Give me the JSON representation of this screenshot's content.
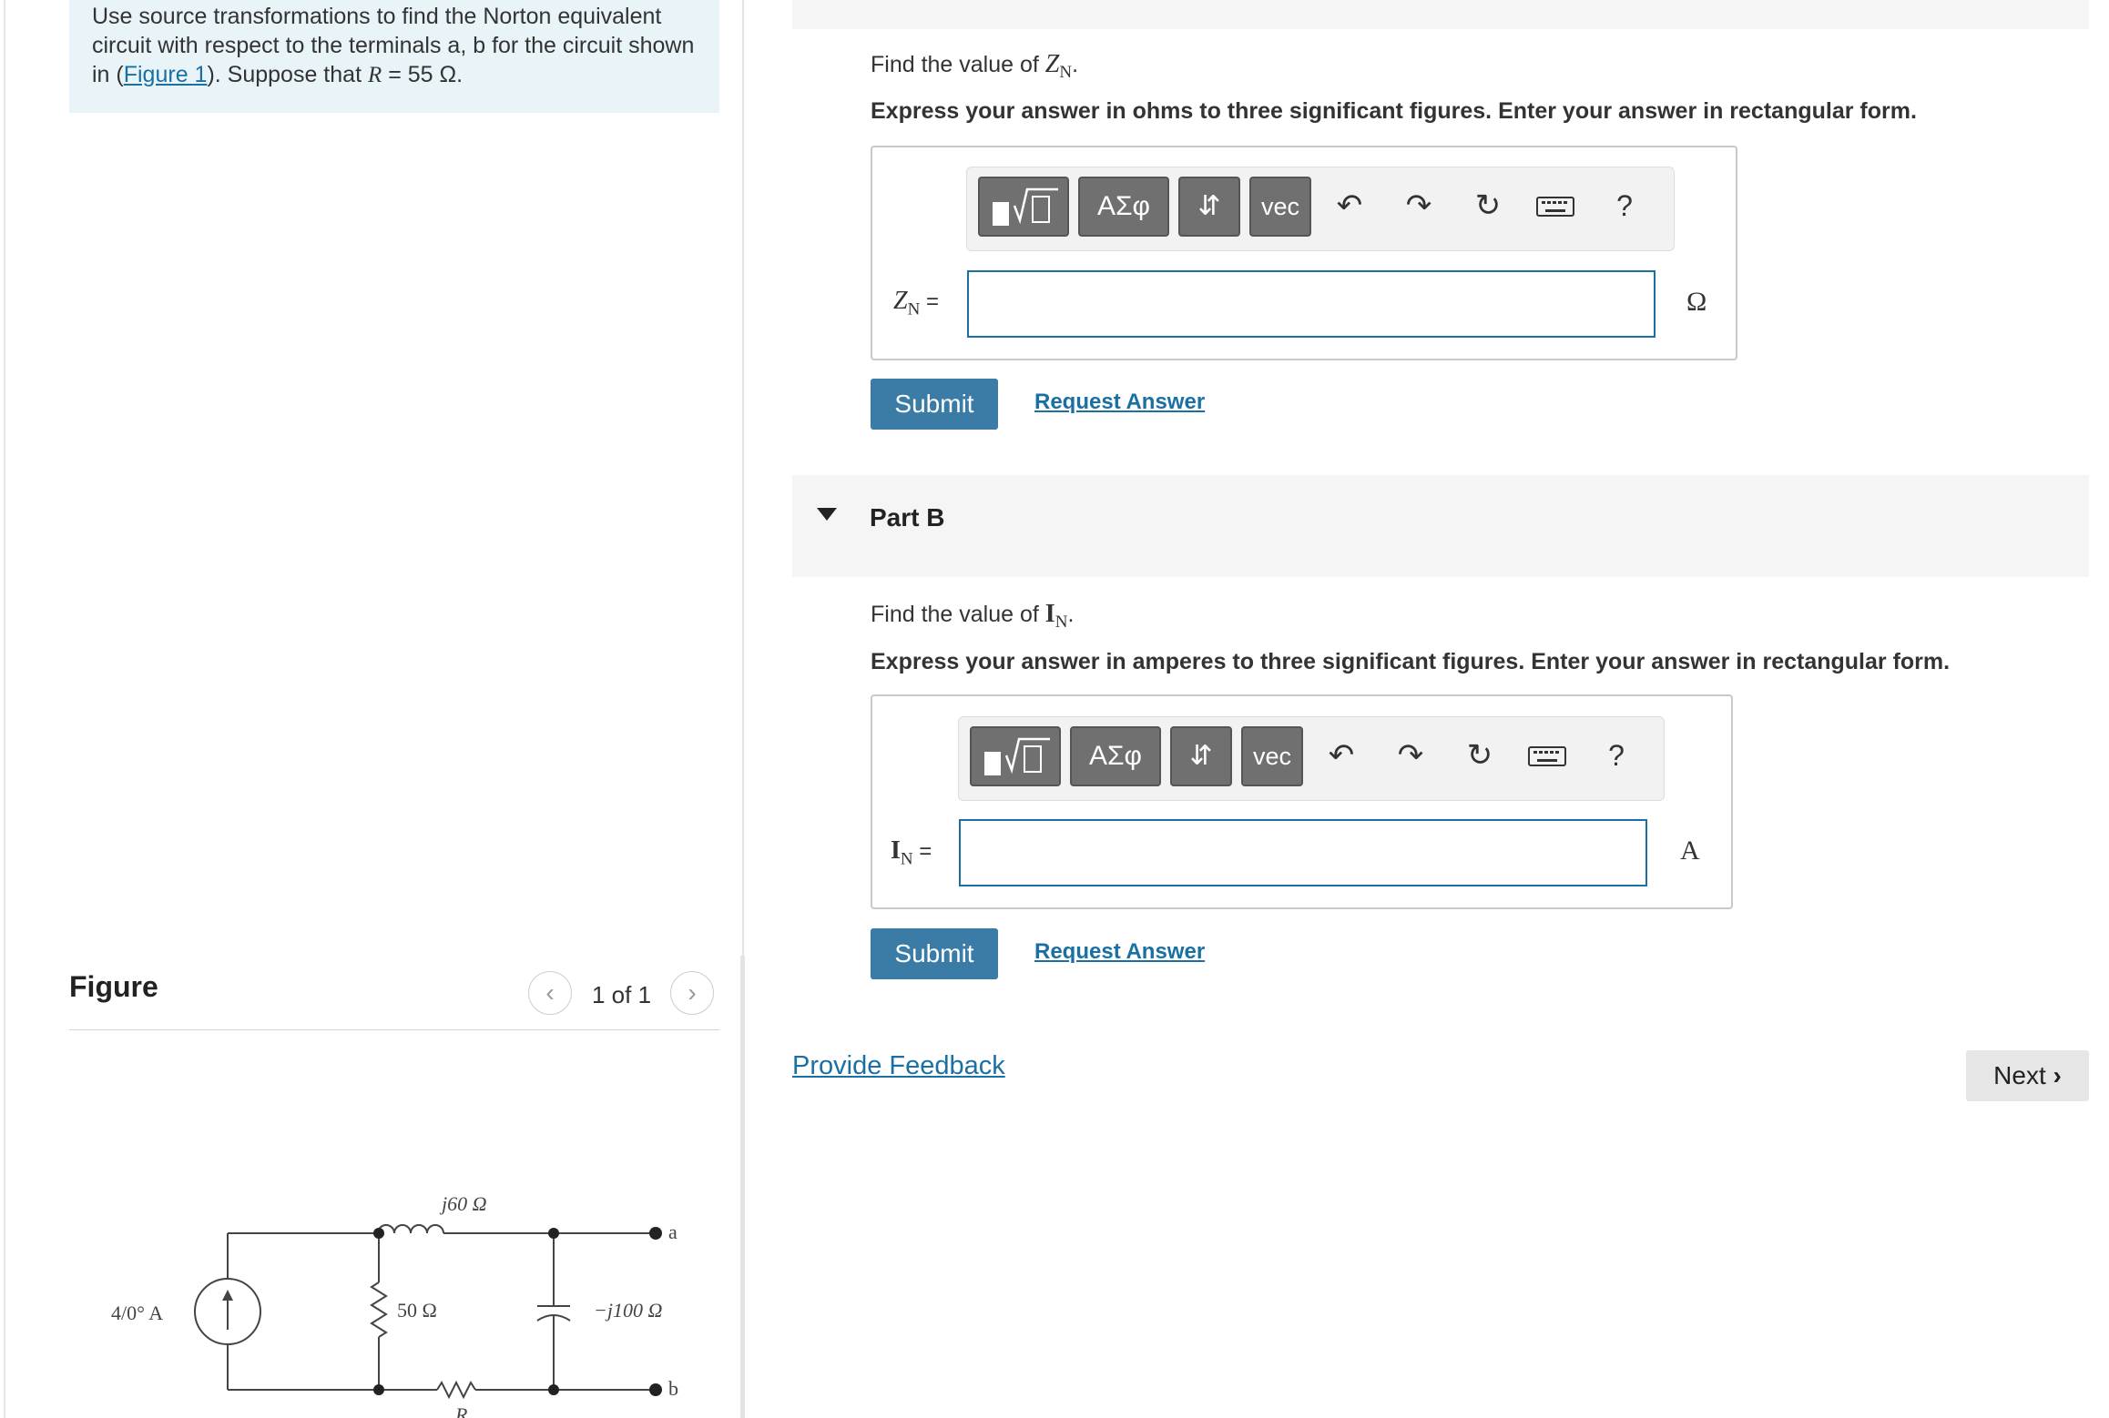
{
  "problem": {
    "text_pre": "Use source transformations to find the Norton equivalent circuit with respect to the terminals a, b for the circuit shown in (",
    "figure_link": "Figure 1",
    "text_post": "). Suppose that ",
    "r_symbol": "R",
    "r_value": " = 55 Ω."
  },
  "figure": {
    "title": "Figure",
    "pager": "1 of 1",
    "prev_glyph": "‹",
    "next_glyph": "›",
    "circuit_labels": {
      "source": "4/0° A",
      "inductor": "j60 Ω",
      "resistor_50": "50 Ω",
      "capacitor": "−j100 Ω",
      "resistor_r": "R",
      "terminal_a": "a",
      "terminal_b": "b"
    }
  },
  "part_a": {
    "prompt_pre": "Find the value of ",
    "prompt_var": "Z",
    "prompt_sub": "N",
    "prompt_post": ".",
    "instruction": "Express your answer in ohms to three significant figures. Enter your answer in rectangular form.",
    "label_var": "Z",
    "label_sub": "N",
    "label_eq": " =",
    "input_value": "",
    "unit": "Ω",
    "submit": "Submit",
    "request": "Request Answer"
  },
  "part_b": {
    "header": "Part B",
    "prompt_pre": "Find the value of ",
    "prompt_var": "I",
    "prompt_sub": "N",
    "prompt_post": ".",
    "instruction": "Express your answer in amperes to three significant figures. Enter your answer in rectangular form.",
    "label_var": "I",
    "label_sub": "N",
    "label_eq": " =",
    "input_value": "",
    "unit": "A",
    "submit": "Submit",
    "request": "Request Answer"
  },
  "toolbar": {
    "greek": "ΑΣφ",
    "arrows": "⇵",
    "vec": "vec",
    "help": "?"
  },
  "footer": {
    "feedback": "Provide Feedback",
    "next": "Next"
  }
}
